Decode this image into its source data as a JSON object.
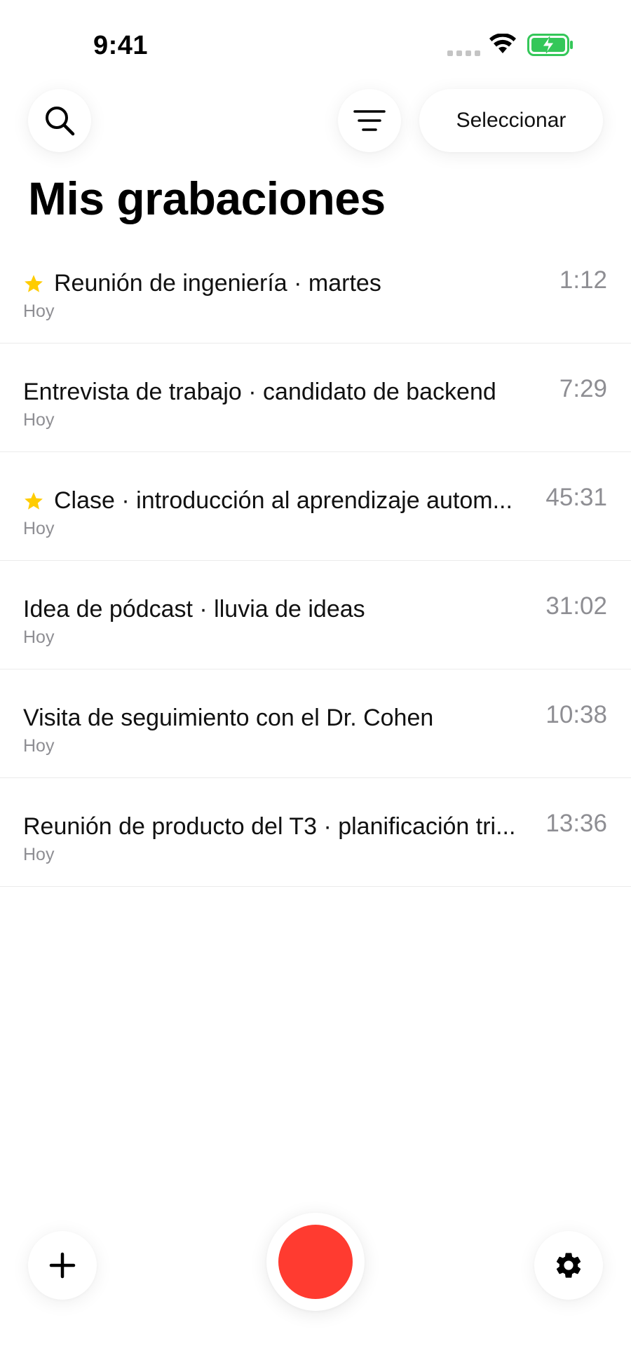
{
  "status_bar": {
    "time": "9:41",
    "icons": [
      "signal-icon",
      "wifi-icon",
      "battery-charging-icon"
    ],
    "battery_color": "#34c759"
  },
  "header": {
    "search_icon": "search-icon",
    "filter_icon": "filter-icon",
    "select_label": "Seleccionar",
    "title": "Mis grabaciones"
  },
  "recordings": [
    {
      "title": "Reunión de ingeniería · martes",
      "date": "Hoy",
      "duration": "1:12",
      "starred": true
    },
    {
      "title": "Entrevista de trabajo · candidato de backend",
      "date": "Hoy",
      "duration": "7:29",
      "starred": false
    },
    {
      "title": "Clase · introducción al aprendizaje autom...",
      "date": "Hoy",
      "duration": "45:31",
      "starred": true
    },
    {
      "title": "Idea de pódcast · lluvia de ideas",
      "date": "Hoy",
      "duration": "31:02",
      "starred": false
    },
    {
      "title": "Visita de seguimiento con el Dr. Cohen",
      "date": "Hoy",
      "duration": "10:38",
      "starred": false
    },
    {
      "title": "Reunión de producto del T3 · planificación tri...",
      "date": "Hoy",
      "duration": "13:36",
      "starred": false
    }
  ],
  "bottom_bar": {
    "add_icon": "plus-icon",
    "record_icon": "record-icon",
    "settings_icon": "gear-icon",
    "record_color": "#ff3b30"
  },
  "colors": {
    "star": "#ffcc00",
    "secondary_text": "#8e8e93",
    "divider": "#ebebeb"
  }
}
